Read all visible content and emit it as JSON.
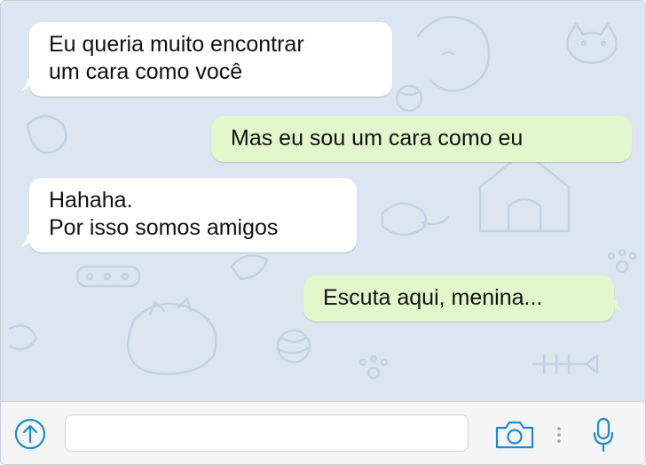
{
  "messages": [
    {
      "direction": "incoming",
      "text": "Eu queria muito encontrar\num cara como você"
    },
    {
      "direction": "outgoing",
      "text": "Mas eu sou um cara como eu"
    },
    {
      "direction": "incoming",
      "text": "Hahaha.\nPor isso somos amigos"
    },
    {
      "direction": "outgoing",
      "text": "Escuta aqui, menina..."
    }
  ],
  "composer": {
    "value": "",
    "placeholder": ""
  },
  "icons": {
    "attach": "upload-arrow-icon",
    "camera": "camera-icon",
    "more": "vertical-dots-icon",
    "mic": "microphone-icon"
  },
  "colors": {
    "chat_background": "#dce6f1",
    "incoming_bubble": "#ffffff",
    "outgoing_bubble": "#e2f8cc",
    "accent": "#1e8ad6",
    "input_bar": "#f5f5f5"
  }
}
